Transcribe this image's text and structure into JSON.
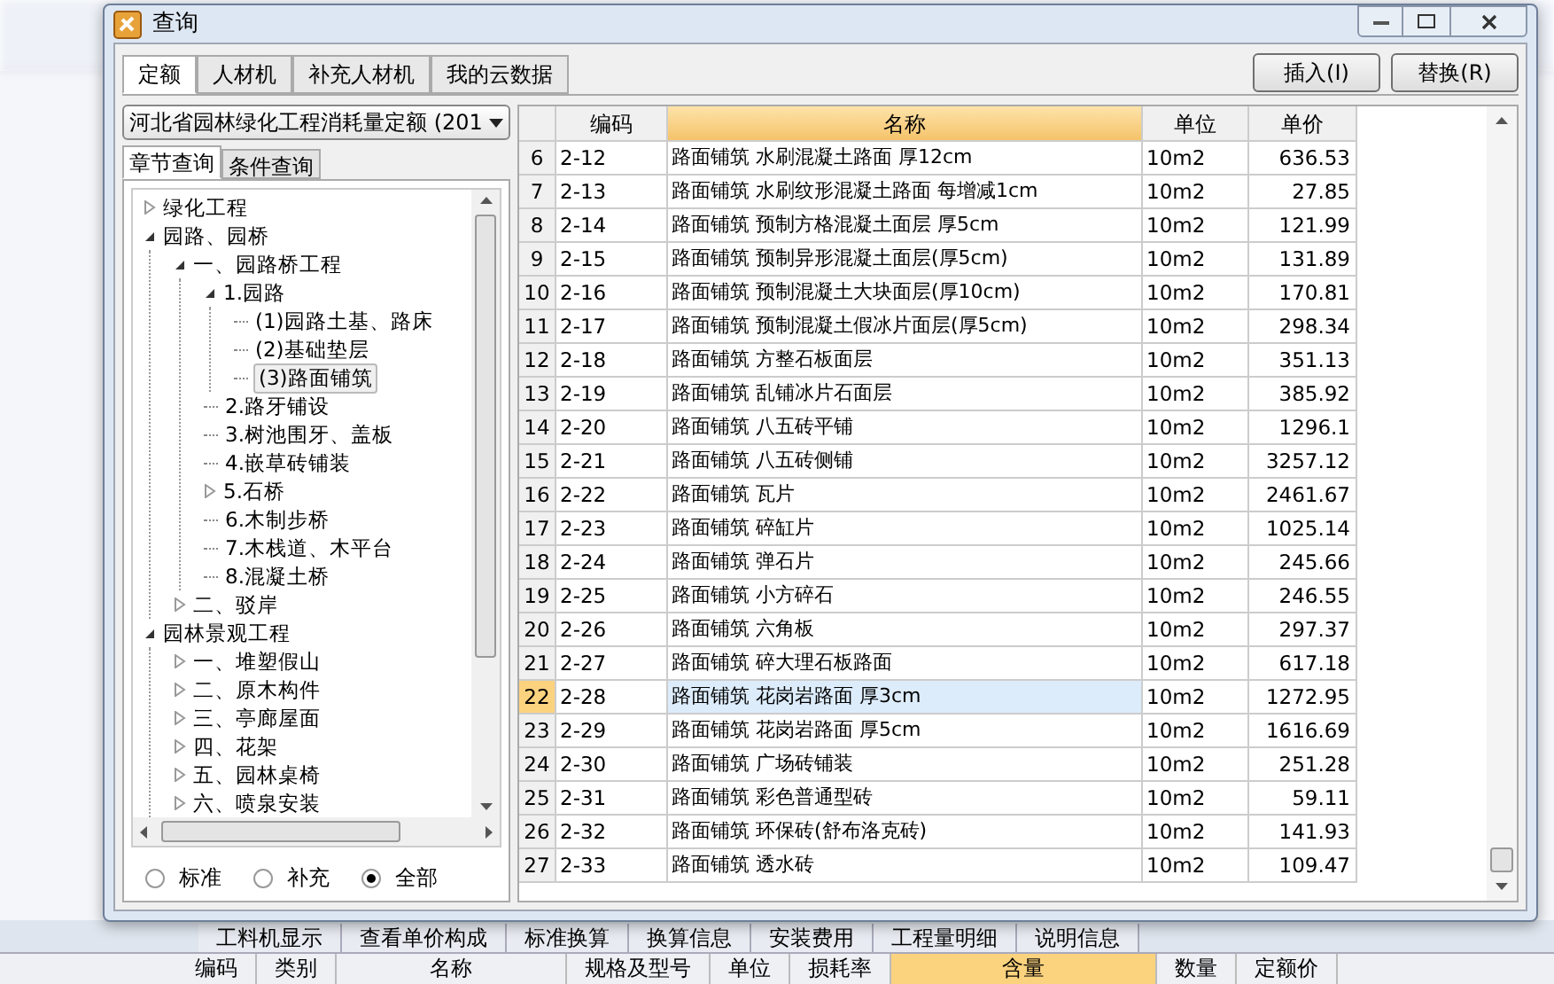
{
  "window": {
    "title": "查询"
  },
  "tabs": [
    {
      "label": "定额",
      "selected": true
    },
    {
      "label": "人材机",
      "selected": false
    },
    {
      "label": "补充人材机",
      "selected": false
    },
    {
      "label": "我的云数据",
      "selected": false
    }
  ],
  "buttons": [
    "插入(I)",
    "替换(R)"
  ],
  "library_dropdown": {
    "value": "河北省园林绿化工程消耗量定额 (201"
  },
  "sub_tabs": [
    {
      "label": "章节查询",
      "selected": true
    },
    {
      "label": "条件查询",
      "selected": false
    }
  ],
  "tree": [
    {
      "label": "绿化工程",
      "expanded": false,
      "selected": false
    },
    {
      "label": "园路、园桥",
      "expanded": true,
      "selected": false,
      "children": [
        {
          "label": "一、园路桥工程",
          "expanded": true,
          "selected": false,
          "children": [
            {
              "label": "1.园路",
              "expanded": true,
              "selected": false,
              "children": [
                {
                  "label": "(1)园路土基、路床",
                  "selected": false
                },
                {
                  "label": "(2)基础垫层",
                  "selected": false
                },
                {
                  "label": "(3)路面铺筑",
                  "selected": true
                }
              ]
            },
            {
              "label": "2.路牙铺设",
              "selected": false
            },
            {
              "label": "3.树池围牙、盖板",
              "selected": false
            },
            {
              "label": "4.嵌草砖铺装",
              "selected": false
            },
            {
              "label": "5.石桥",
              "expanded": false,
              "selected": false
            },
            {
              "label": "6.木制步桥",
              "selected": false
            },
            {
              "label": "7.木栈道、木平台",
              "selected": false
            },
            {
              "label": "8.混凝土桥",
              "selected": false
            }
          ]
        },
        {
          "label": "二、驳岸",
          "expanded": false,
          "selected": false
        }
      ]
    },
    {
      "label": "园林景观工程",
      "expanded": true,
      "selected": false,
      "children": [
        {
          "label": "一、堆塑假山",
          "expanded": false,
          "selected": false
        },
        {
          "label": "二、原木构件",
          "expanded": false,
          "selected": false
        },
        {
          "label": "三、亭廊屋面",
          "expanded": false,
          "selected": false
        },
        {
          "label": "四、花架",
          "expanded": false,
          "selected": false
        },
        {
          "label": "五、园林桌椅",
          "expanded": false,
          "selected": false
        },
        {
          "label": "六、喷泉安装",
          "expanded": false,
          "selected": false
        }
      ]
    }
  ],
  "radios": [
    {
      "label": "标准",
      "selected": false
    },
    {
      "label": "补充",
      "selected": false
    },
    {
      "label": "全部",
      "selected": true
    }
  ],
  "table": {
    "columns": [
      "编码",
      "名称",
      "单位",
      "单价"
    ],
    "rows": [
      {
        "index": "6",
        "code": "2-12",
        "name": "路面铺筑 水刷混凝土路面 厚12cm",
        "unit": "10m2",
        "price": "636.53",
        "selected": false
      },
      {
        "index": "7",
        "code": "2-13",
        "name": "路面铺筑 水刷纹形混凝土路面 每增减1cm",
        "unit": "10m2",
        "price": "27.85",
        "selected": false
      },
      {
        "index": "8",
        "code": "2-14",
        "name": "路面铺筑 预制方格混凝土面层 厚5cm",
        "unit": "10m2",
        "price": "121.99",
        "selected": false
      },
      {
        "index": "9",
        "code": "2-15",
        "name": "路面铺筑 预制异形混凝土面层(厚5cm)",
        "unit": "10m2",
        "price": "131.89",
        "selected": false
      },
      {
        "index": "10",
        "code": "2-16",
        "name": "路面铺筑 预制混凝土大块面层(厚10cm)",
        "unit": "10m2",
        "price": "170.81",
        "selected": false
      },
      {
        "index": "11",
        "code": "2-17",
        "name": "路面铺筑 预制混凝土假冰片面层(厚5cm)",
        "unit": "10m2",
        "price": "298.34",
        "selected": false
      },
      {
        "index": "12",
        "code": "2-18",
        "name": "路面铺筑 方整石板面层",
        "unit": "10m2",
        "price": "351.13",
        "selected": false
      },
      {
        "index": "13",
        "code": "2-19",
        "name": "路面铺筑 乱铺冰片石面层",
        "unit": "10m2",
        "price": "385.92",
        "selected": false
      },
      {
        "index": "14",
        "code": "2-20",
        "name": "路面铺筑 八五砖平铺",
        "unit": "10m2",
        "price": "1296.1",
        "selected": false
      },
      {
        "index": "15",
        "code": "2-21",
        "name": "路面铺筑 八五砖侧铺",
        "unit": "10m2",
        "price": "3257.12",
        "selected": false
      },
      {
        "index": "16",
        "code": "2-22",
        "name": "路面铺筑 瓦片",
        "unit": "10m2",
        "price": "2461.67",
        "selected": false
      },
      {
        "index": "17",
        "code": "2-23",
        "name": "路面铺筑 碎缸片",
        "unit": "10m2",
        "price": "1025.14",
        "selected": false
      },
      {
        "index": "18",
        "code": "2-24",
        "name": "路面铺筑 弹石片",
        "unit": "10m2",
        "price": "245.66",
        "selected": false
      },
      {
        "index": "19",
        "code": "2-25",
        "name": "路面铺筑 小方碎石",
        "unit": "10m2",
        "price": "246.55",
        "selected": false
      },
      {
        "index": "20",
        "code": "2-26",
        "name": "路面铺筑 六角板",
        "unit": "10m2",
        "price": "297.37",
        "selected": false
      },
      {
        "index": "21",
        "code": "2-27",
        "name": "路面铺筑 碎大理石板路面",
        "unit": "10m2",
        "price": "617.18",
        "selected": false
      },
      {
        "index": "22",
        "code": "2-28",
        "name": "路面铺筑 花岗岩路面 厚3cm",
        "unit": "10m2",
        "price": "1272.95",
        "selected": true
      },
      {
        "index": "23",
        "code": "2-29",
        "name": "路面铺筑 花岗岩路面 厚5cm",
        "unit": "10m2",
        "price": "1616.69",
        "selected": false
      },
      {
        "index": "24",
        "code": "2-30",
        "name": "路面铺筑 广场砖铺装",
        "unit": "10m2",
        "price": "251.28",
        "selected": false
      },
      {
        "index": "25",
        "code": "2-31",
        "name": "路面铺筑 彩色普通型砖",
        "unit": "10m2",
        "price": "59.11",
        "selected": false
      },
      {
        "index": "26",
        "code": "2-32",
        "name": "路面铺筑 环保砖(舒布洛克砖)",
        "unit": "10m2",
        "price": "141.93",
        "selected": false
      },
      {
        "index": "27",
        "code": "2-33",
        "name": "路面铺筑 透水砖",
        "unit": "10m2",
        "price": "109.47",
        "selected": false
      }
    ]
  },
  "background_tabs": [
    {
      "label": "工料机显示",
      "selected": false
    },
    {
      "label": "查看单价构成",
      "selected": false
    },
    {
      "label": "标准换算",
      "selected": false
    },
    {
      "label": "换算信息",
      "selected": false
    },
    {
      "label": "安装费用",
      "selected": false
    },
    {
      "label": "工程量明细",
      "selected": false
    },
    {
      "label": "说明信息",
      "selected": false
    }
  ],
  "background_columns": [
    {
      "label": "编码",
      "selected": false
    },
    {
      "label": "类别",
      "selected": false
    },
    {
      "label": "名称",
      "selected": false
    },
    {
      "label": "规格及型号",
      "selected": false
    },
    {
      "label": "单位",
      "selected": false
    },
    {
      "label": "损耗率",
      "selected": false
    },
    {
      "label": "含量",
      "selected": true
    },
    {
      "label": "数量",
      "selected": false
    },
    {
      "label": "定额价",
      "selected": false
    }
  ]
}
